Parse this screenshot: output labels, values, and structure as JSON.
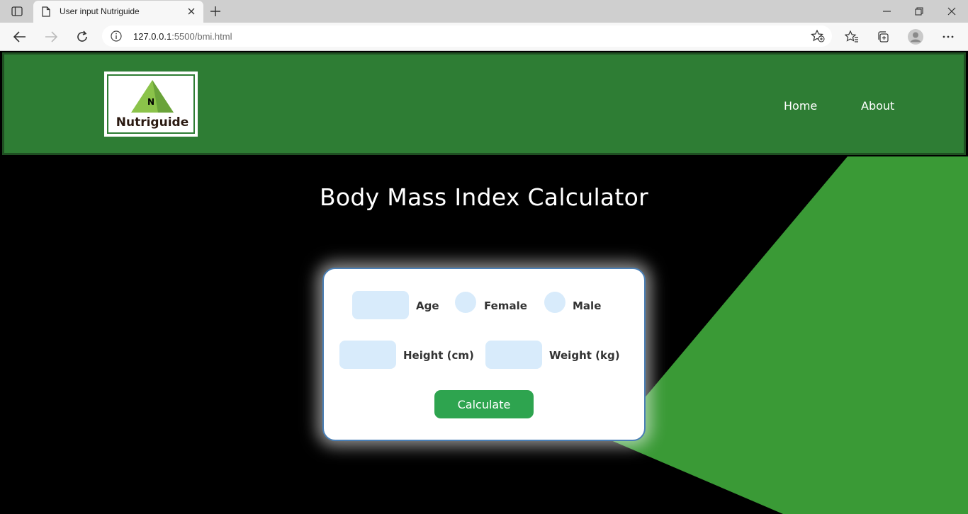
{
  "browser": {
    "tab_title": "User input Nutriguide",
    "url_host": "127.0.0.1",
    "url_rest": ":5500/bmi.html"
  },
  "site": {
    "logo_letter": "N",
    "logo_text": "Nutriguide",
    "nav": [
      "Home",
      "About"
    ]
  },
  "page": {
    "title": "Body Mass Index Calculator"
  },
  "form": {
    "age_label": "Age",
    "female_label": "Female",
    "male_label": "Male",
    "height_label": "Height (cm)",
    "weight_label": "Weight (kg)",
    "age_value": "",
    "height_value": "",
    "weight_value": "",
    "button_label": "Calculate"
  },
  "colors": {
    "header_green": "#2e7d34",
    "accent_green": "#3a9a36",
    "button_green": "#2ea44f",
    "input_blue": "#d8ebfb"
  }
}
